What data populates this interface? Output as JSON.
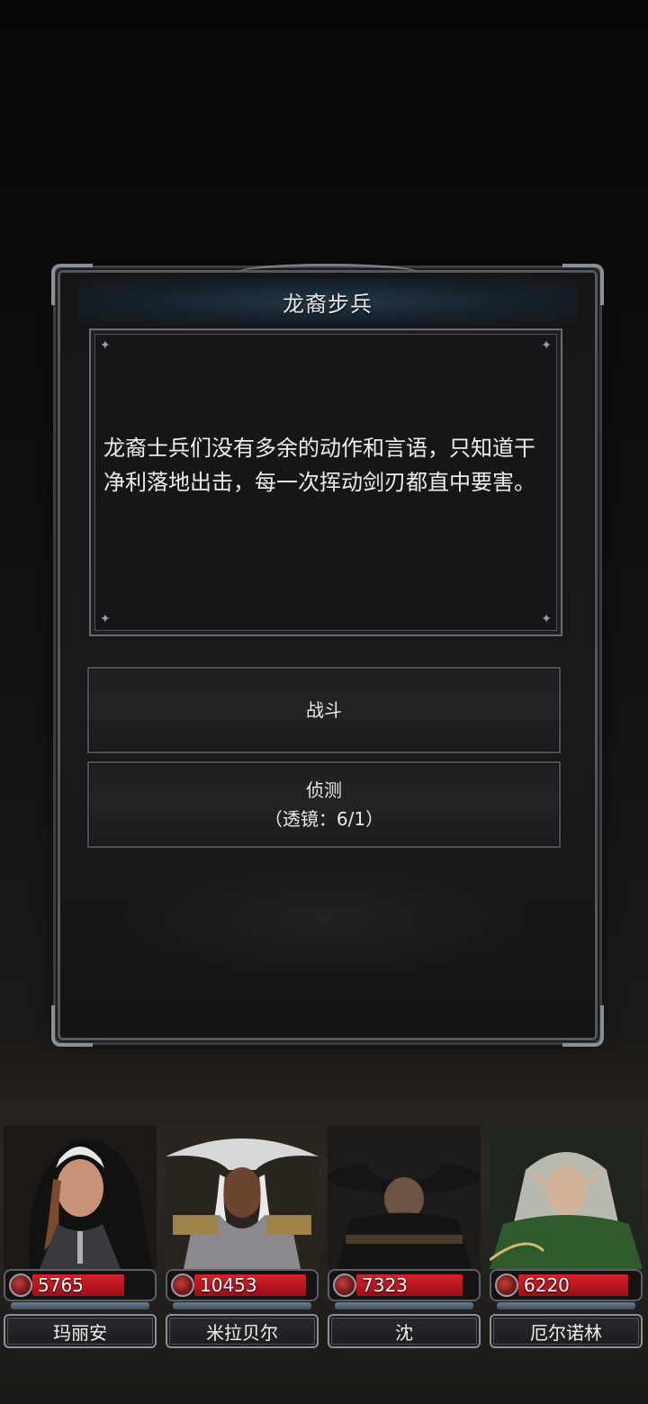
{
  "dialog": {
    "title": "龙裔步兵",
    "description": "龙裔士兵们没有多余的动作和言语，只知道干净利落地出击，每一次挥动剑刃都直中要害。",
    "choices": {
      "fight_label": "战斗",
      "scout_label": "侦测",
      "scout_sub": "（透镜：6/1）"
    }
  },
  "party": [
    {
      "name": "玛丽安",
      "hp": "5765",
      "hp_fraction": 0.82,
      "color": "#5b2e2e"
    },
    {
      "name": "米拉贝尔",
      "hp": "10453",
      "hp_fraction": 1.0,
      "color": "#7a6a4a"
    },
    {
      "name": "沈",
      "hp": "7323",
      "hp_fraction": 0.95,
      "color": "#3a3028"
    },
    {
      "name": "厄尔诺林",
      "hp": "6220",
      "hp_fraction": 0.97,
      "color": "#3b5a38"
    }
  ]
}
